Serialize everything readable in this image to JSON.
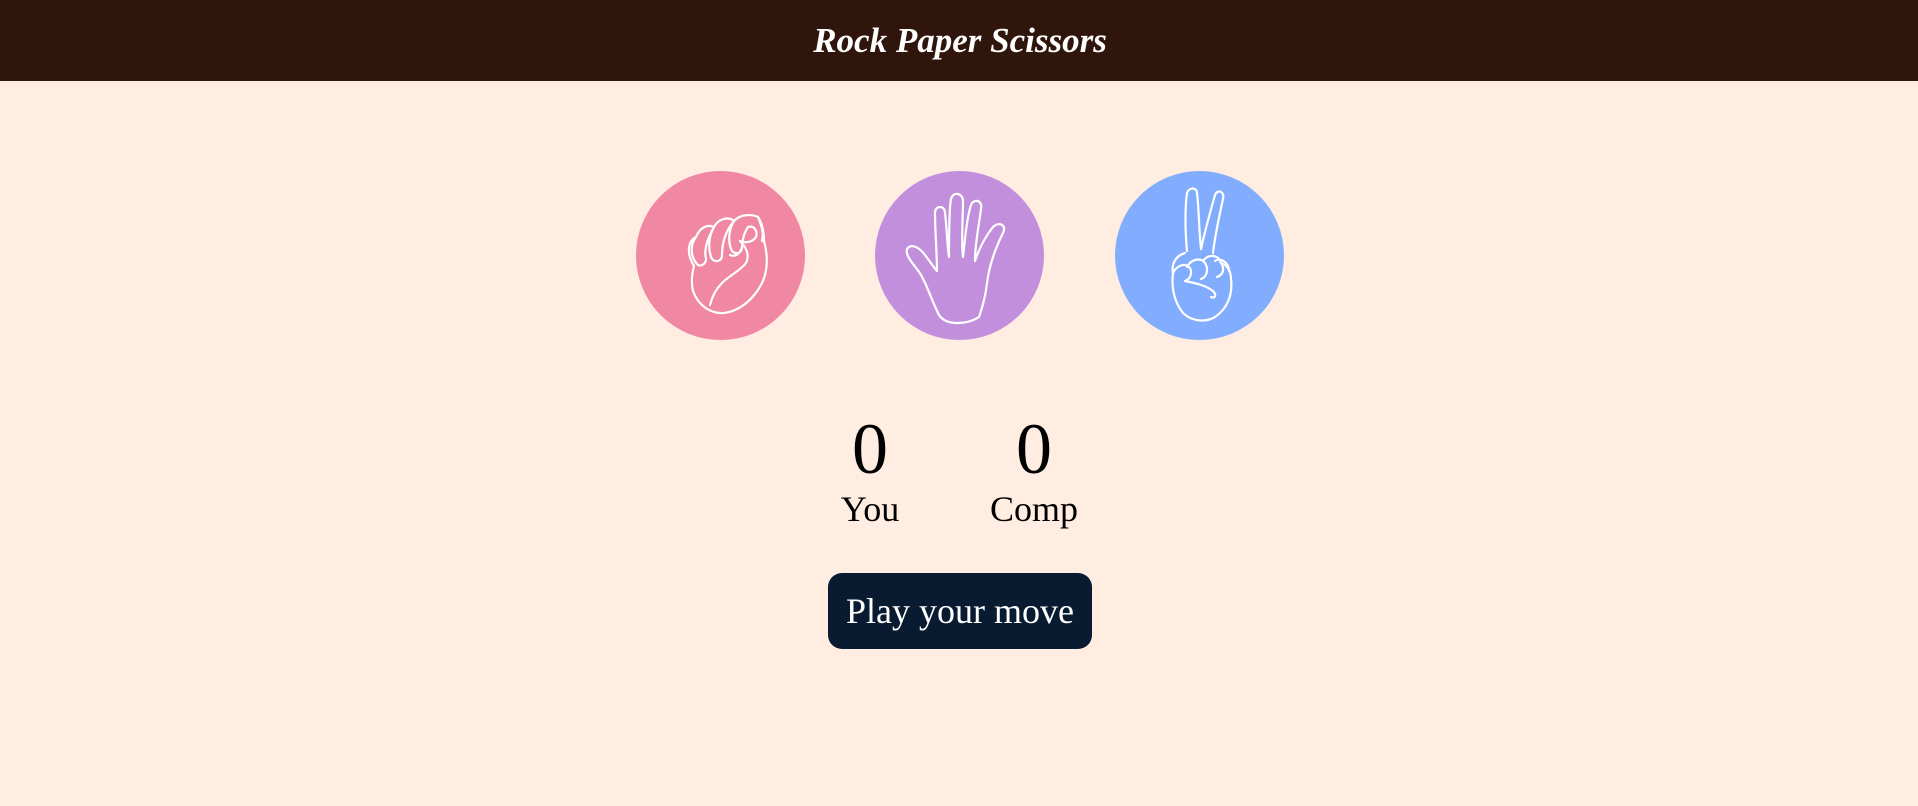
{
  "header": {
    "title": "Rock Paper Scissors"
  },
  "choices": [
    {
      "id": "rock",
      "icon": "fist-icon",
      "color": "#f087a3"
    },
    {
      "id": "paper",
      "icon": "open-hand-icon",
      "color": "#c28fdd"
    },
    {
      "id": "scissors",
      "icon": "peace-hand-icon",
      "color": "#82adff"
    }
  ],
  "scoreboard": {
    "user_score": "0",
    "user_label": "You",
    "comp_score": "0",
    "comp_label": "Comp"
  },
  "message": {
    "label": "Play your move",
    "background": "#081b31"
  },
  "colors": {
    "header_bg": "#2f150b",
    "page_bg": "#ffede2"
  }
}
